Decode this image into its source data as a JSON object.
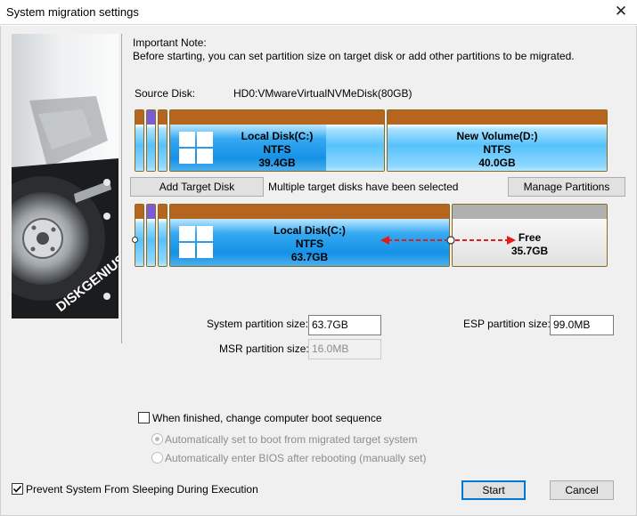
{
  "window": {
    "title": "System migration settings",
    "close_glyph": "✕"
  },
  "note": {
    "heading": "Important Note:",
    "text": "Before starting, you can set partition size on target disk or add other partitions to be migrated."
  },
  "source": {
    "label": "Source Disk:",
    "disk_name": "HD0:VMwareVirtualNVMeDisk(80GB)",
    "partitions": [
      {
        "name": "Local Disk(C:)",
        "fs": "NTFS",
        "size": "39.4GB",
        "used_fraction": 0.73
      },
      {
        "name": "New Volume(D:)",
        "fs": "NTFS",
        "size": "40.0GB"
      }
    ]
  },
  "target": {
    "add_button": "Add Target Disk",
    "status_text": "Multiple target disks have been selected",
    "manage_button": "Manage Partitions",
    "partitions": [
      {
        "name": "Local Disk(C:)",
        "fs": "NTFS",
        "size": "63.7GB"
      },
      {
        "name": "Free",
        "size": "35.7GB"
      }
    ]
  },
  "sizes": {
    "system_label": "System partition size:",
    "system_value": "63.7GB",
    "msr_label": "MSR partition size:",
    "msr_value": "16.0MB",
    "esp_label": "ESP partition size:",
    "esp_value": "99.0MB"
  },
  "boot": {
    "checkbox_label": "When finished, change computer boot sequence",
    "checked": false,
    "option1": "Automatically set to boot from migrated target system",
    "option2": "Automatically enter BIOS after rebooting (manually set)"
  },
  "footer": {
    "prevent_sleep_label": "Prevent System From Sleeping During Execution",
    "prevent_sleep_checked": true,
    "start_button": "Start",
    "cancel_button": "Cancel"
  },
  "brand": {
    "logo_text": "DISKGENIUS"
  },
  "colors": {
    "partition_cap": "#b5651d",
    "partition_blue": "#56c2fb",
    "used_blue": "#1591e6",
    "free_gray": "#e4e4e4",
    "free_cap": "#b0b0b0",
    "arrow_red": "#e31b1b",
    "primary_border": "#0078d7"
  }
}
